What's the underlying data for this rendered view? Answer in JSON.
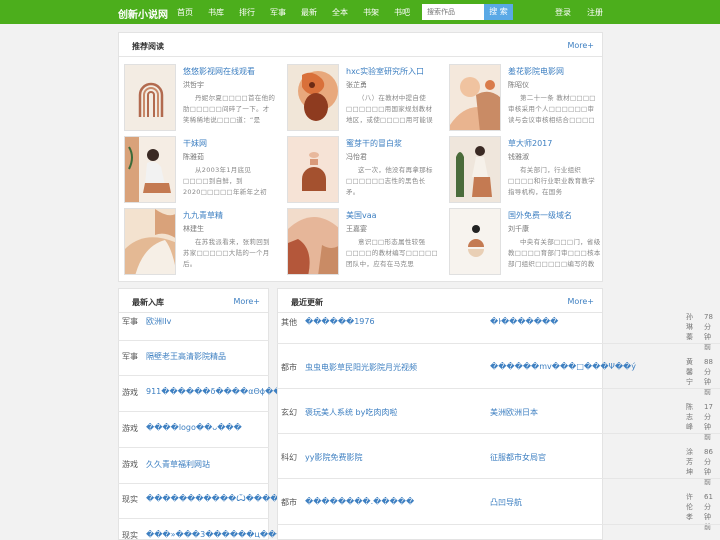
{
  "header": {
    "logo": "创新小说网",
    "nav": [
      "首页",
      "书库",
      "排行",
      "军事",
      "最新",
      "全本",
      "书架",
      "书吧"
    ],
    "search_placeholder": "搜索作品",
    "search_button": "搜 索",
    "login": "登录",
    "register": "注册"
  },
  "recommend": {
    "title": "推荐阅读",
    "more": "More+",
    "books": [
      {
        "name": "悠悠影视网在线观看",
        "author": "洪哲宇",
        "desc": "丹妮尔夏□□□□首在他的肋□□□□□间碎了一下。才笑稀稀地说□□□道：“是"
      },
      {
        "name": "hxc实验室研究所入口",
        "author": "张芷勇",
        "desc": "（八）在教材中提自使□□□□□□用国家规划教材地区，或使□□□□用可能误导高"
      },
      {
        "name": "羞花影院电影网",
        "author": "陈昭仪",
        "desc": "第二十一条 教材□□□□审核采用个人□□□□□□审读与会议审核相结合□□□□的方式。"
      },
      {
        "name": "干妹网",
        "author": "陈雅茹",
        "desc": "从2003年1月底见□□□□到自鲜，到2020□□□□□年新年之初□□□□□听闻自鲜灭"
      },
      {
        "name": "蜜芽干的冒白浆",
        "author": "冯怡君",
        "desc": "这一次，他没有再拿那标□□□□□□志性的黑色长矛。"
      },
      {
        "name": "草大师2017",
        "author": "钱雅淑",
        "desc": "有关部门，行业组织□□□□和行业职业教育教学指导机构，在国务"
      },
      {
        "name": "九九青草精",
        "author": "林建生",
        "desc": "在苏我派看来，张莉回到苏家□□□□□大陆的一个月后。"
      },
      {
        "name": "美国vaa",
        "author": "王嘉宴",
        "desc": "意识□□形态属性较强□□□□的教材编写□□□□□团队中，应有在马克思"
      },
      {
        "name": "国外免费一级域名",
        "author": "刘千康",
        "desc": "中央有关部□□□门，省级教□□□□育部门审□□□核本部门组织□□□□□编写的教"
      }
    ]
  },
  "new_books": {
    "title": "最新入库",
    "more": "More+",
    "items": [
      {
        "cat": "军事",
        "name": "欧洲lIv"
      },
      {
        "cat": "军事",
        "name": "隔壁老王高清影院精品"
      },
      {
        "cat": "游戏",
        "name": "911������δ����αΘϕ��"
      },
      {
        "cat": "游戏",
        "name": "����logo��ᴗ���"
      },
      {
        "cat": "游戏",
        "name": "久久青草福利网站"
      },
      {
        "cat": "现实",
        "name": "�����������Ѽ����"
      },
      {
        "cat": "现实",
        "name": "���»���3������ц���"
      }
    ]
  },
  "latest": {
    "title": "最近更新",
    "more": "More+",
    "items": [
      {
        "cat": "其他",
        "name": "������1976",
        "chapter": "�ŀ�������",
        "author": "孙琳蓁",
        "time": "78分钟前"
      },
      {
        "cat": "都市",
        "name": "虫虫电影草民阳光影院月光视频",
        "chapter": "������mv���□���Ψ��ý",
        "author": "黄馨宁",
        "time": "88分钟前"
      },
      {
        "cat": "玄幻",
        "name": "褒玩美人系统 by吃肉肉啦",
        "chapter": "美洲欧洲日本",
        "author": "陈志峰",
        "time": "17分钟前"
      },
      {
        "cat": "科幻",
        "name": "yy影院免费影院",
        "chapter": "征服都市女局官",
        "author": "涂芳坤",
        "time": "86分钟前"
      },
      {
        "cat": "都市",
        "name": "��������.�����",
        "chapter": "凸凹导航",
        "author": "许伦孝",
        "time": "61分钟前"
      }
    ]
  },
  "colors": {
    "brand": "#4cae1c",
    "link": "#3d7fc1",
    "search_button": "#5aa9e6"
  }
}
